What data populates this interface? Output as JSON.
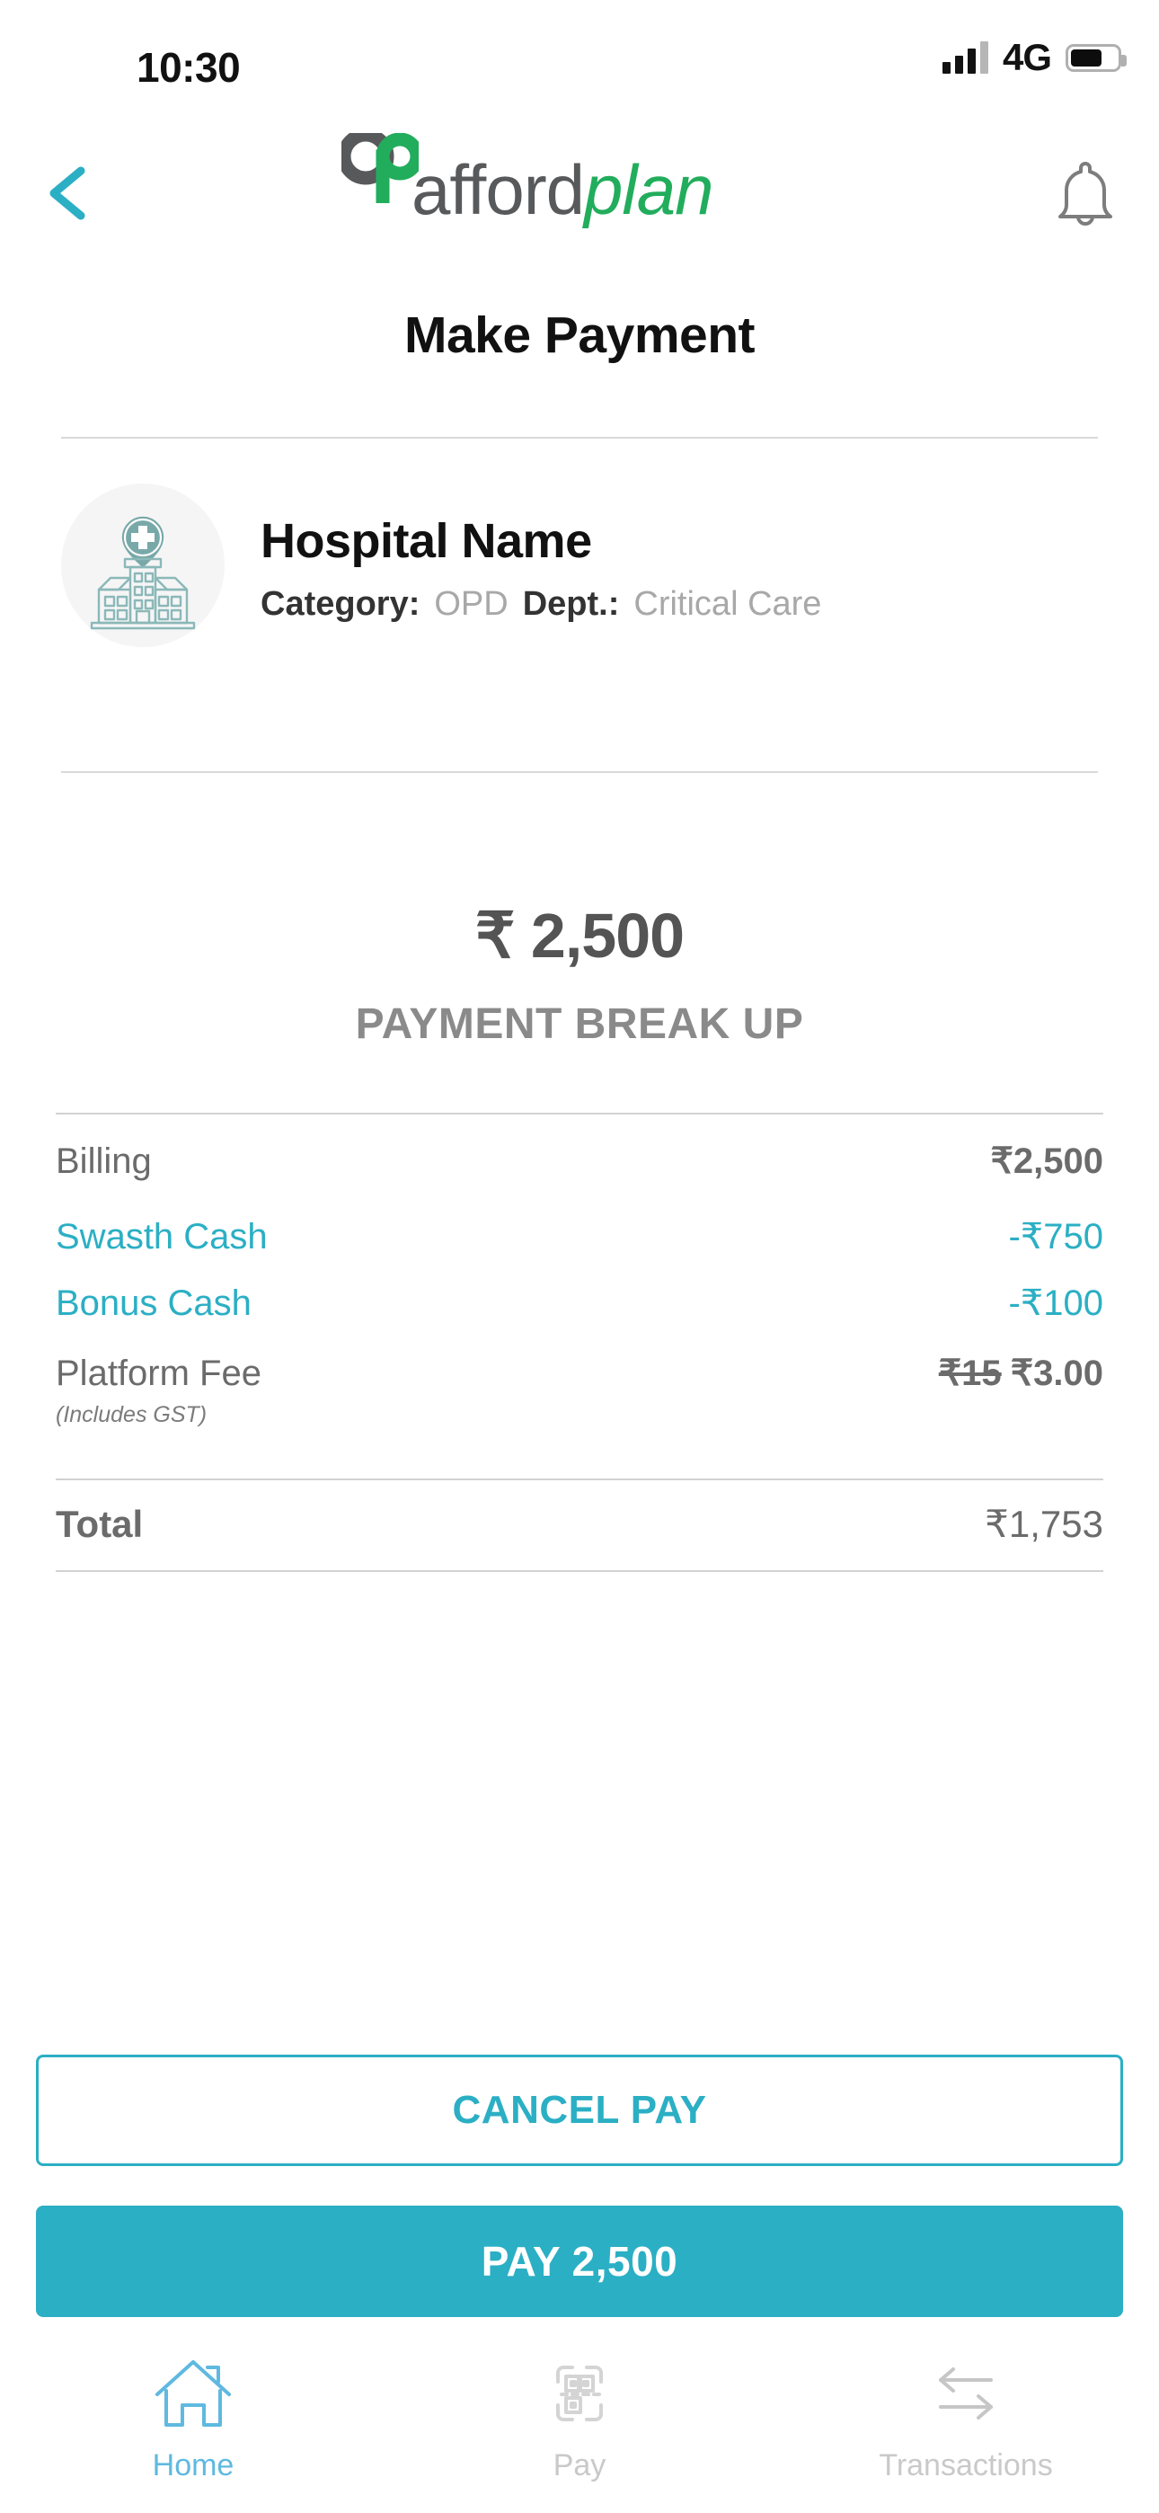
{
  "status_bar": {
    "time": "10:30",
    "network": "4G",
    "signal_icon": "signal-bars-icon",
    "signal_bars_filled": 3,
    "signal_bars_total": 4,
    "battery_icon": "battery-icon",
    "battery_percent": 60
  },
  "header": {
    "back_icon": "chevron-left-icon",
    "notification_icon": "bell-icon",
    "logo": {
      "mark_icon": "affordplan-logo-icon",
      "word_primary": "afford",
      "word_secondary": "plan",
      "color_primary": "#58595b",
      "color_secondary": "#22ad5c"
    },
    "page_title": "Make Payment"
  },
  "hospital": {
    "icon": "hospital-building-icon",
    "name": "Hospital Name",
    "category_label": "Category:",
    "category_value": "OPD",
    "dept_label": "Dept.:",
    "dept_value": "Critical Care"
  },
  "summary": {
    "amount": "₹ 2,500",
    "breakup_title": "PAYMENT BREAK UP"
  },
  "breakup": {
    "rows": [
      {
        "label": "Billing",
        "value": "₹2,500",
        "accent": false
      },
      {
        "label": "Swasth Cash",
        "value": "-₹750",
        "accent": true
      },
      {
        "label": "Bonus Cash",
        "value": "-₹100",
        "accent": true
      }
    ],
    "platform_fee": {
      "label": "Platform Fee",
      "note": "(Includes GST)",
      "original_value": "₹15",
      "value": "₹3.00"
    },
    "total": {
      "label": "Total",
      "value": "₹1,753"
    }
  },
  "actions": {
    "cancel_label": "CANCEL PAY",
    "pay_label": "PAY 2,500"
  },
  "bottom_nav": {
    "items": [
      {
        "label": "Home",
        "icon": "home-icon",
        "active": true
      },
      {
        "label": "Pay",
        "icon": "qr-scan-icon",
        "active": false
      },
      {
        "label": "Transactions",
        "icon": "transfer-arrows-icon",
        "active": false
      }
    ]
  },
  "colors": {
    "accent_teal": "#2bafc4",
    "brand_green": "#22ad5c",
    "brand_gray": "#58595b",
    "nav_active": "#5fb9e0",
    "text_muted": "#6b6b6b"
  }
}
